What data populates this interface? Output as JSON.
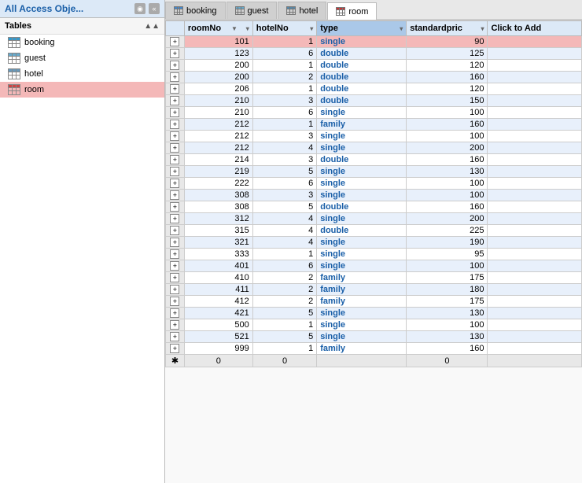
{
  "leftPanel": {
    "title": "All Access Obje...",
    "sections": [
      {
        "label": "Tables",
        "items": [
          {
            "name": "booking",
            "iconClass": "booking"
          },
          {
            "name": "guest",
            "iconClass": "guest"
          },
          {
            "name": "hotel",
            "iconClass": "hotel"
          },
          {
            "name": "room",
            "iconClass": "room",
            "active": true
          }
        ]
      }
    ]
  },
  "tabs": [
    {
      "label": "booking",
      "iconClass": "booking",
      "active": false
    },
    {
      "label": "guest",
      "iconClass": "guest",
      "active": false
    },
    {
      "label": "hotel",
      "iconClass": "hotel",
      "active": false
    },
    {
      "label": "room",
      "iconClass": "room",
      "active": true
    }
  ],
  "columns": [
    {
      "key": "expand",
      "label": "",
      "cssClass": "col-expand"
    },
    {
      "key": "roomNo",
      "label": "roomNo",
      "cssClass": "col-roomNo",
      "sortArrow": "▼",
      "dropdown": true
    },
    {
      "key": "hotelNo",
      "label": "hotelNo",
      "cssClass": "col-hotelNo",
      "dropdown": true
    },
    {
      "key": "type",
      "label": "type",
      "cssClass": "col-type",
      "dropdown": true,
      "active": true
    },
    {
      "key": "standardPrice",
      "label": "standardpric",
      "cssClass": "col-standardPrice",
      "dropdown": true
    },
    {
      "key": "clickToAdd",
      "label": "Click to Add",
      "cssClass": "col-clickToAdd"
    }
  ],
  "rows": [
    {
      "roomNo": 101,
      "hotelNo": 1,
      "type": "single",
      "standardPrice": 90,
      "highlight": true
    },
    {
      "roomNo": 123,
      "hotelNo": 6,
      "type": "double",
      "standardPrice": 125
    },
    {
      "roomNo": 200,
      "hotelNo": 1,
      "type": "double",
      "standardPrice": 120
    },
    {
      "roomNo": 200,
      "hotelNo": 2,
      "type": "double",
      "standardPrice": 160
    },
    {
      "roomNo": 206,
      "hotelNo": 1,
      "type": "double",
      "standardPrice": 120
    },
    {
      "roomNo": 210,
      "hotelNo": 3,
      "type": "double",
      "standardPrice": 150
    },
    {
      "roomNo": 210,
      "hotelNo": 6,
      "type": "single",
      "standardPrice": 100
    },
    {
      "roomNo": 212,
      "hotelNo": 1,
      "type": "family",
      "standardPrice": 160
    },
    {
      "roomNo": 212,
      "hotelNo": 3,
      "type": "single",
      "standardPrice": 100
    },
    {
      "roomNo": 212,
      "hotelNo": 4,
      "type": "single",
      "standardPrice": 200
    },
    {
      "roomNo": 214,
      "hotelNo": 3,
      "type": "double",
      "standardPrice": 160
    },
    {
      "roomNo": 219,
      "hotelNo": 5,
      "type": "single",
      "standardPrice": 130
    },
    {
      "roomNo": 222,
      "hotelNo": 6,
      "type": "single",
      "standardPrice": 100
    },
    {
      "roomNo": 308,
      "hotelNo": 3,
      "type": "single",
      "standardPrice": 100
    },
    {
      "roomNo": 308,
      "hotelNo": 5,
      "type": "double",
      "standardPrice": 160
    },
    {
      "roomNo": 312,
      "hotelNo": 4,
      "type": "single",
      "standardPrice": 200
    },
    {
      "roomNo": 315,
      "hotelNo": 4,
      "type": "double",
      "standardPrice": 225
    },
    {
      "roomNo": 321,
      "hotelNo": 4,
      "type": "single",
      "standardPrice": 190
    },
    {
      "roomNo": 333,
      "hotelNo": 1,
      "type": "single",
      "standardPrice": 95
    },
    {
      "roomNo": 401,
      "hotelNo": 6,
      "type": "single",
      "standardPrice": 100
    },
    {
      "roomNo": 410,
      "hotelNo": 2,
      "type": "family",
      "standardPrice": 175
    },
    {
      "roomNo": 411,
      "hotelNo": 2,
      "type": "family",
      "standardPrice": 180
    },
    {
      "roomNo": 412,
      "hotelNo": 2,
      "type": "family",
      "standardPrice": 175
    },
    {
      "roomNo": 421,
      "hotelNo": 5,
      "type": "single",
      "standardPrice": 130
    },
    {
      "roomNo": 500,
      "hotelNo": 1,
      "type": "single",
      "standardPrice": 100
    },
    {
      "roomNo": 521,
      "hotelNo": 5,
      "type": "single",
      "standardPrice": 130
    },
    {
      "roomNo": 999,
      "hotelNo": 1,
      "type": "family",
      "standardPrice": 160
    }
  ],
  "newRow": {
    "roomNo": 0,
    "hotelNo": 0,
    "standardPrice": 0
  }
}
